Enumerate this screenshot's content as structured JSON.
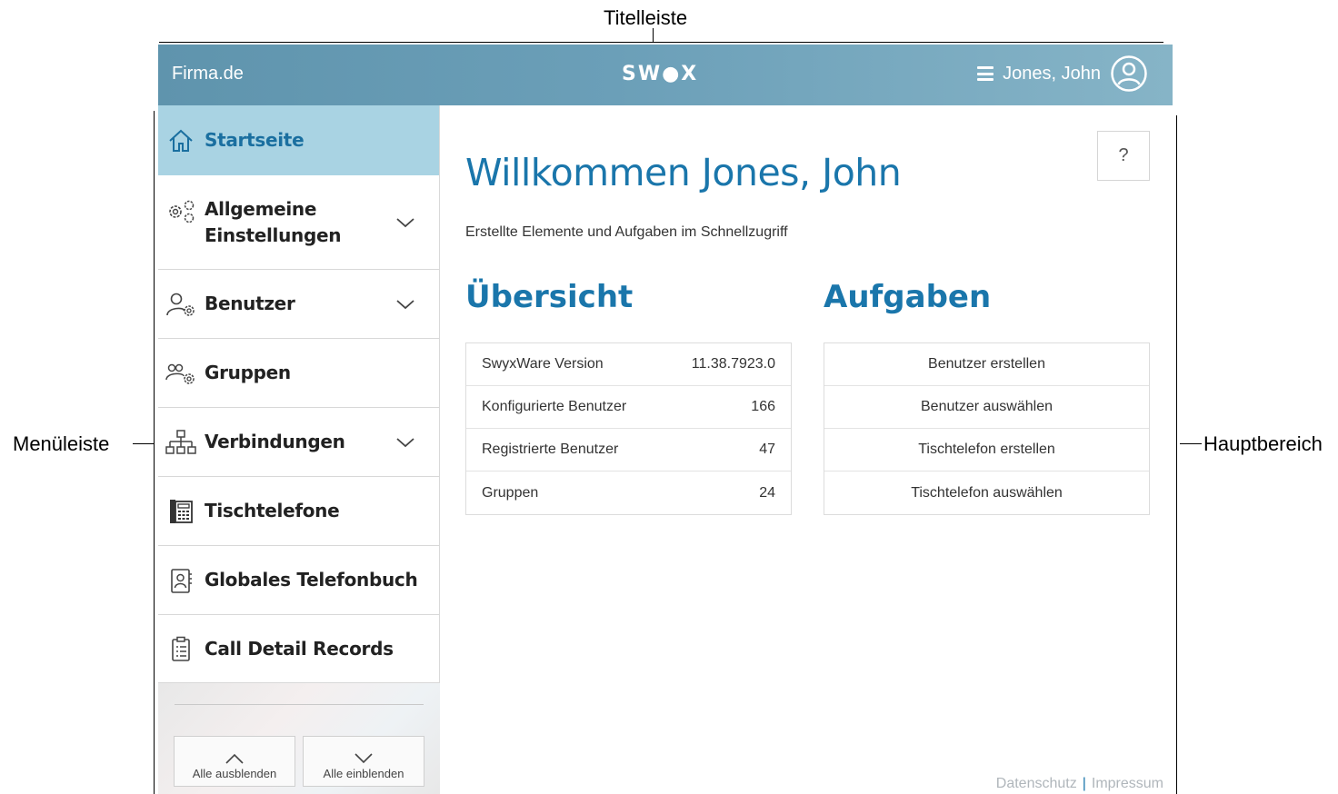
{
  "annotations": {
    "title_bar": "Titelleiste",
    "menu_bar": "Menüleiste",
    "main_area": "Hauptbereich"
  },
  "titlebar": {
    "domain": "Firma.de",
    "logo": "SW●X",
    "user_name": "Jones, John",
    "menu_icon": "hamburger-icon",
    "avatar_icon": "user-circle-icon",
    "bg_color": "#6b9fb8"
  },
  "sidebar": {
    "items": [
      {
        "label": "Startseite",
        "icon": "home-icon",
        "active": true
      },
      {
        "label": "Allgemeine Einstellungen",
        "line1": "Allgemeine",
        "line2": "Einstellungen",
        "icon": "gears-icon",
        "expandable": true
      },
      {
        "label": "Benutzer",
        "icon": "user-settings-icon",
        "expandable": true
      },
      {
        "label": "Gruppen",
        "icon": "group-settings-icon"
      },
      {
        "label": "Verbindungen",
        "icon": "network-icon",
        "expandable": true
      },
      {
        "label": "Tischtelefone",
        "icon": "desk-phone-icon"
      },
      {
        "label": "Globales Telefonbuch",
        "icon": "phonebook-icon"
      },
      {
        "label": "Call Detail Records",
        "icon": "clipboard-icon"
      }
    ],
    "collapse_all": "Alle ausblenden",
    "expand_all": "Alle einblenden",
    "active_color": "#a9d3e3"
  },
  "main": {
    "help_label": "?",
    "welcome": "Willkommen Jones, John",
    "subtitle": "Erstellte Elemente und Aufgaben im Schnellzugriff",
    "overview_title": "Übersicht",
    "tasks_title": "Aufgaben",
    "overview": [
      {
        "label": "SwyxWare Version",
        "value": "11.38.7923.0"
      },
      {
        "label": "Konfigurierte Benutzer",
        "value": "166"
      },
      {
        "label": "Registrierte Benutzer",
        "value": "47"
      },
      {
        "label": "Gruppen",
        "value": "24"
      }
    ],
    "tasks": [
      {
        "label": "Benutzer erstellen"
      },
      {
        "label": "Benutzer auswählen"
      },
      {
        "label": "Tischtelefon erstellen"
      },
      {
        "label": "Tischtelefon auswählen"
      }
    ],
    "footer": {
      "privacy": "Datenschutz",
      "imprint": "Impressum"
    },
    "accent_color": "#1a76ab"
  }
}
